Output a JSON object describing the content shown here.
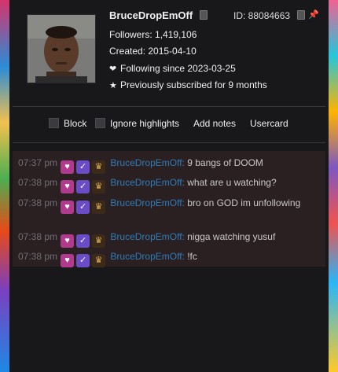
{
  "user": {
    "name": "BruceDropEmOff",
    "id_label": "ID: 88084663",
    "followers": "Followers: 1,419,106",
    "created": "Created: 2015-04-10",
    "following_since": "Following since 2023-03-25",
    "previously_subscribed": "Previously subscribed for 9 months"
  },
  "icons": {
    "copy": "copy-icon",
    "pin": "pin-icon",
    "heart": "❤",
    "star": "★"
  },
  "actions": {
    "block": "Block",
    "ignore_highlights": "Ignore highlights",
    "add_notes": "Add notes",
    "usercard": "Usercard"
  },
  "messages": [
    {
      "time": "07:37 pm",
      "user": "BruceDropEmOff:",
      "text": "9 bangs of DOOM"
    },
    {
      "time": "07:38 pm",
      "user": "BruceDropEmOff:",
      "text": "what are u watching?"
    },
    {
      "time": "07:38 pm",
      "user": "BruceDropEmOff:",
      "text": "bro on GOD im unfollowing"
    },
    {
      "time": "07:38 pm",
      "user": "BruceDropEmOff:",
      "text": "nigga watching yusuf"
    },
    {
      "time": "07:38 pm",
      "user": "BruceDropEmOff:",
      "text": "!fc"
    }
  ],
  "colors": {
    "username": "#2e7bb8",
    "timestamp": "#6e6e74",
    "log_background": "#2b2021",
    "card_background": "#18181b"
  }
}
